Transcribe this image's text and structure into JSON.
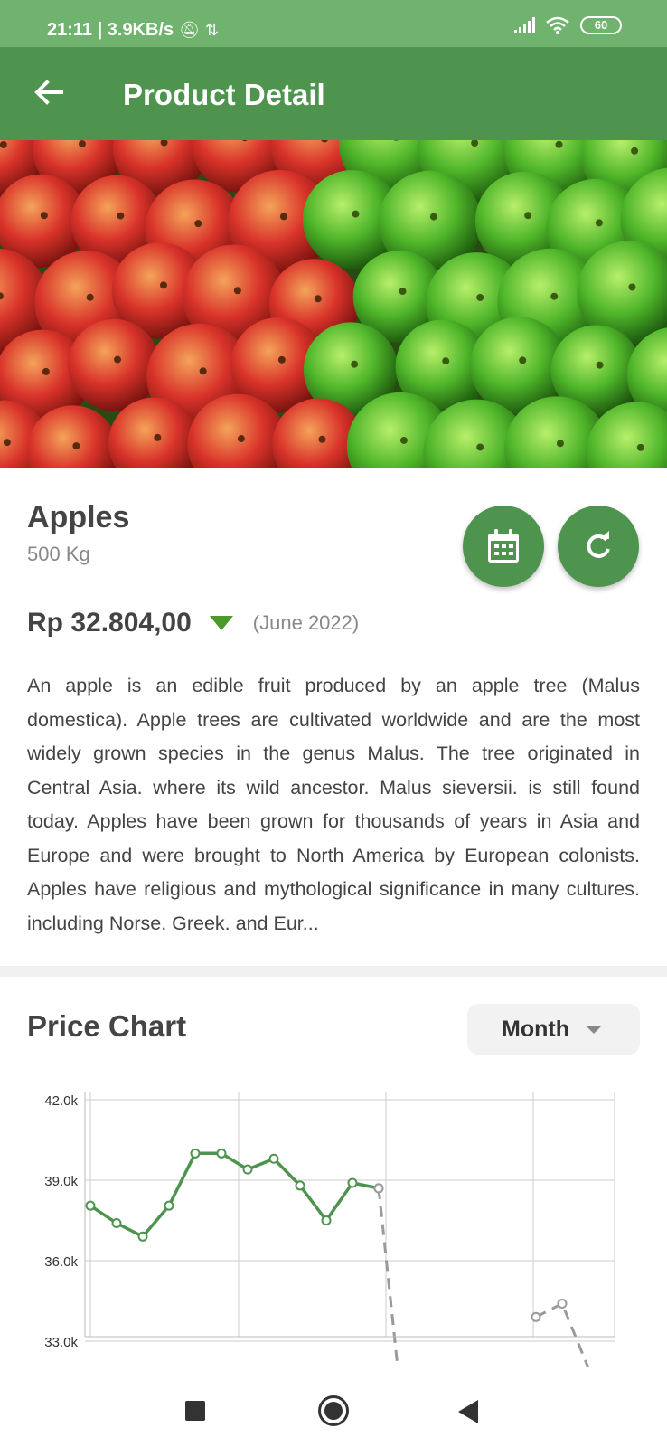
{
  "status_bar": {
    "time_speed": "21:11 | 3.9KB/s",
    "battery": "60"
  },
  "app_bar": {
    "title": "Product Detail"
  },
  "product": {
    "name": "Apples",
    "weight": "500 Kg",
    "price": "Rp 32.804,00",
    "price_date": "(June 2022)",
    "trend": "down",
    "description": "An apple is an edible fruit produced by an apple tree (Malus domestica). Apple trees are cultivated worldwide and are the most widely grown species in the genus Malus. The tree originated in Central Asia. where its wild ancestor. Malus sieversii. is still found today. Apples have been grown for thousands of years in Asia and Europe and were brought to North America by European colonists. Apples have religious and mythological significance in many cultures. including Norse. Greek. and Eur..."
  },
  "icons": {
    "back": "arrow-left-icon",
    "calendar": "calendar-icon",
    "refresh": "refresh-icon"
  },
  "colors": {
    "primary": "#4e944f",
    "status_bar": "#6fb36f",
    "trend_down": "#4a9a2a",
    "forecast_line": "#9a9a9a"
  },
  "chart_section": {
    "title": "Price Chart",
    "period": "Month"
  },
  "chart_data": {
    "type": "line",
    "y_tick_labels": [
      "42.0k",
      "39.0k",
      "36.0k",
      "33.0k"
    ],
    "ylim": [
      33000,
      42500
    ],
    "grid": true,
    "series": [
      {
        "style": "solid",
        "color": "#4e944f",
        "x": [
          0,
          1,
          2,
          3,
          4,
          5,
          6,
          7,
          8,
          9,
          10,
          11,
          12
        ],
        "y": [
          38050,
          37400,
          36900,
          38050,
          40000,
          40000,
          39400,
          39800,
          38800,
          37500,
          38900,
          38700,
          null
        ]
      },
      {
        "style": "dashed",
        "color": "#9a9a9a",
        "x": [
          11,
          12,
          13,
          14,
          15,
          16,
          17,
          18,
          19,
          20
        ],
        "y": [
          38700,
          29500,
          null,
          null,
          null,
          null,
          33900,
          34400,
          32000,
          null
        ]
      }
    ]
  }
}
